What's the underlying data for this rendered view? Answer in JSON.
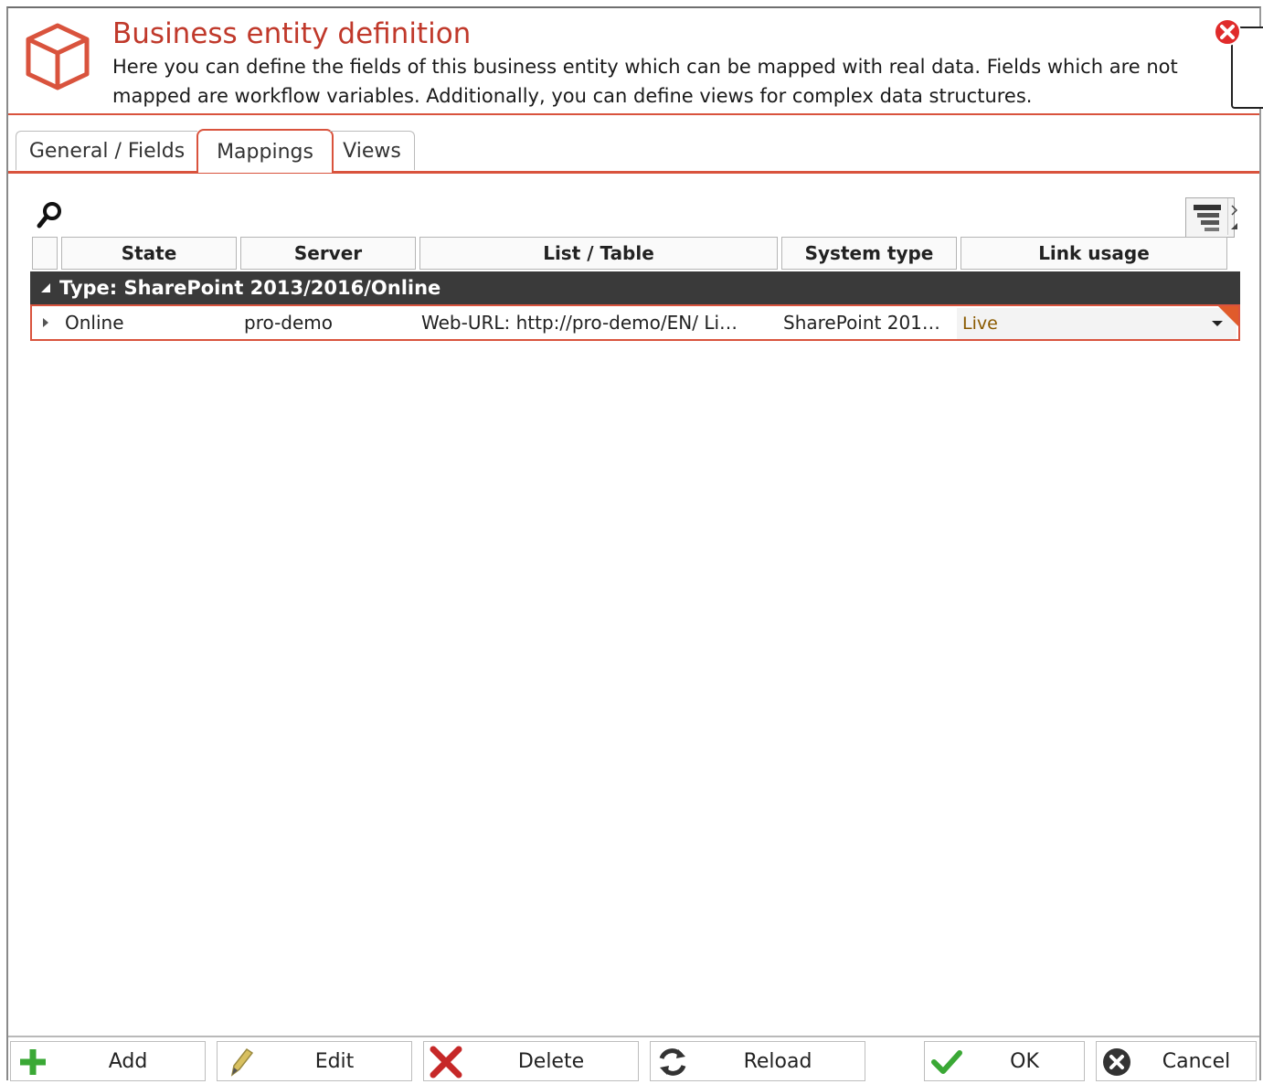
{
  "header": {
    "title": "Business entity definition",
    "description": "Here you can define the fields of this business entity which can be mapped with real data. Fields which are not mapped are workflow variables. Additionally, you can define views for complex data structures."
  },
  "tabs": [
    {
      "label": "General / Fields",
      "active": false
    },
    {
      "label": "Mappings",
      "active": true
    },
    {
      "label": "Views",
      "active": false
    }
  ],
  "grid": {
    "columns": [
      "State",
      "Server",
      "List / Table",
      "System type",
      "Link usage"
    ],
    "group_label": "Type: SharePoint 2013/2016/Online",
    "rows": [
      {
        "state": "Online",
        "server": "pro-demo",
        "list_table": "Web-URL: http://pro-demo/EN/ Li…",
        "system_type": "SharePoint 201…",
        "link_usage": "Live"
      }
    ]
  },
  "footer": {
    "add": "Add",
    "edit": "Edit",
    "delete": "Delete",
    "reload": "Reload",
    "ok": "OK",
    "cancel": "Cancel"
  },
  "colors": {
    "accent": "#d9533d",
    "title": "#c0392b",
    "group_bg": "#3a3a3a"
  }
}
